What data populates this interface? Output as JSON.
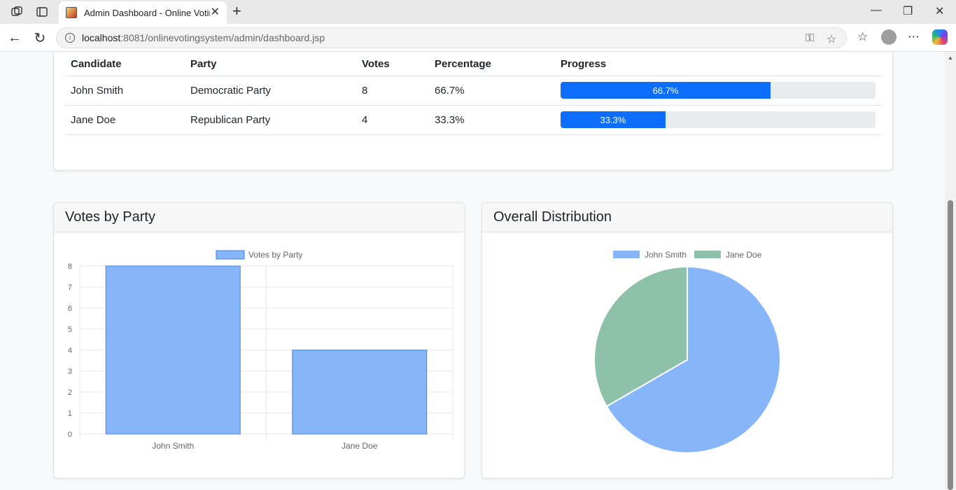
{
  "browser": {
    "tab_title": "Admin Dashboard - Online Voting",
    "url_host": "localhost",
    "url_rest": ":8081/onlinevotingsystem/admin/dashboard.jsp"
  },
  "results_table": {
    "headers": [
      "Candidate",
      "Party",
      "Votes",
      "Percentage",
      "Progress"
    ],
    "rows": [
      {
        "candidate": "John Smith",
        "party": "Democratic Party",
        "votes": "8",
        "percentage": "66.7%",
        "progress_label": "66.7%",
        "progress": 66.7
      },
      {
        "candidate": "Jane Doe",
        "party": "Republican Party",
        "votes": "4",
        "percentage": "33.3%",
        "progress_label": "33.3%",
        "progress": 33.3
      }
    ]
  },
  "bar_panel": {
    "title": "Votes by Party"
  },
  "pie_panel": {
    "title": "Overall Distribution"
  },
  "colors": {
    "bar_fill": "#86b5fa",
    "bar_stroke": "#3b82f6",
    "pie_a": "#86b5fa",
    "pie_b": "#8dc1a9",
    "progress": "#0d6efd"
  },
  "chart_data": [
    {
      "type": "bar",
      "categories": [
        "John Smith",
        "Jane Doe"
      ],
      "series": [
        {
          "name": "Votes by Party",
          "values": [
            8,
            4
          ]
        }
      ],
      "ylim": [
        0,
        8
      ],
      "yticks": [
        "0",
        "1",
        "2",
        "3",
        "4",
        "5",
        "6",
        "7",
        "8"
      ],
      "legend": "top",
      "grid": true
    },
    {
      "type": "pie",
      "labels": [
        "John Smith",
        "Jane Doe"
      ],
      "values": [
        8,
        4
      ],
      "legend": "top"
    }
  ]
}
